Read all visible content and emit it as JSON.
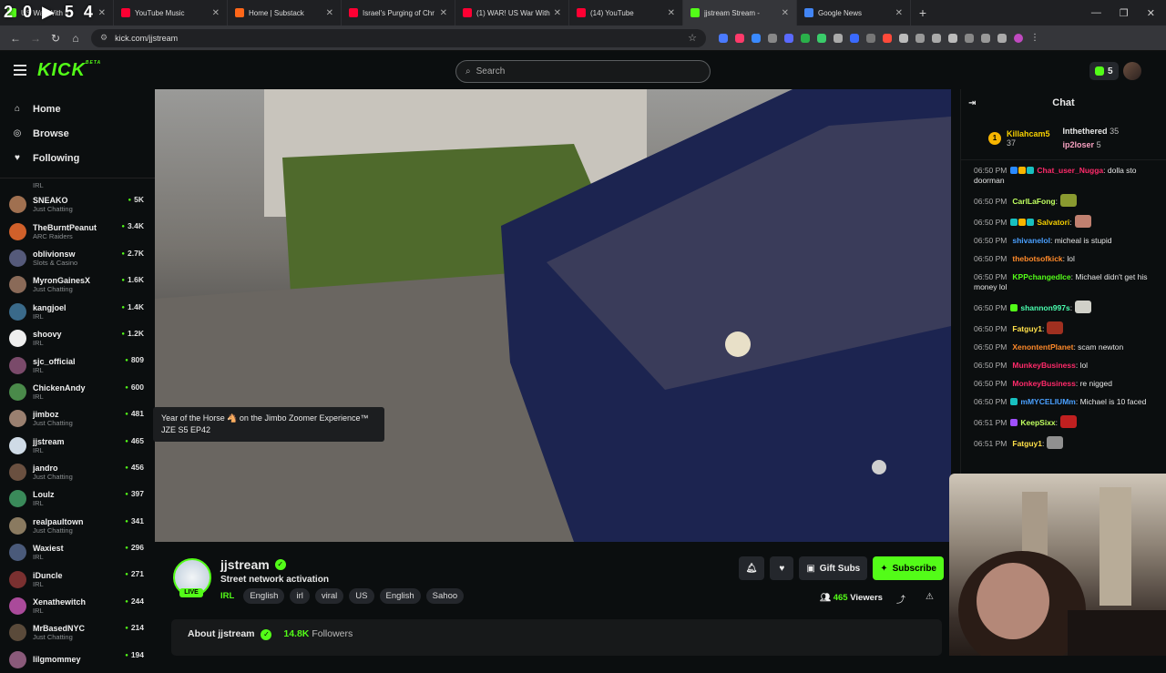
{
  "browser": {
    "tabs": [
      {
        "title": "US War With Ir",
        "color": "#53fc18"
      },
      {
        "title": "YouTube Music",
        "color": "#ff0033"
      },
      {
        "title": "Home | Substack",
        "color": "#ff6719"
      },
      {
        "title": "Israel's Purging of Chr",
        "color": "#ff0033"
      },
      {
        "title": "(1) WAR! US War With",
        "color": "#ff0033"
      },
      {
        "title": "(14) YouTube",
        "color": "#ff0033"
      },
      {
        "title": "jjstream Stream -",
        "color": "#53fc18"
      },
      {
        "title": "Google News",
        "color": "#4285f4"
      }
    ],
    "overlay": "2 0 ▶ 5 4",
    "url": "kick.com/jjstream",
    "newtab": "+",
    "win": [
      "—",
      "❐",
      "✕"
    ]
  },
  "header": {
    "logo": "KICK",
    "beta": "BETA",
    "search_placeholder": "Search",
    "points": "5"
  },
  "nav": [
    {
      "label": "Home",
      "icon": "⌂"
    },
    {
      "label": "Browse",
      "icon": "◎"
    },
    {
      "label": "Following",
      "icon": "♥"
    }
  ],
  "following": [
    {
      "name": "",
      "cat": "IRL",
      "viewers": "",
      "color": "#6a6a6a"
    },
    {
      "name": "SNEAKO",
      "cat": "Just Chatting",
      "viewers": "5K",
      "color": "#a07050"
    },
    {
      "name": "TheBurntPeanut",
      "cat": "ARC Raiders",
      "viewers": "3.4K",
      "color": "#d0602a"
    },
    {
      "name": "oblivionsw",
      "cat": "Slots & Casino",
      "viewers": "2.7K",
      "color": "#555a7a"
    },
    {
      "name": "MyronGainesX",
      "cat": "Just Chatting",
      "viewers": "1.6K",
      "color": "#8a6a58"
    },
    {
      "name": "kangjoel",
      "cat": "IRL",
      "viewers": "1.4K",
      "color": "#3a6a8a"
    },
    {
      "name": "shoovy",
      "cat": "IRL",
      "viewers": "1.2K",
      "color": "#eeeeee"
    },
    {
      "name": "sjc_official",
      "cat": "IRL",
      "viewers": "809",
      "color": "#7a4a6a"
    },
    {
      "name": "ChickenAndy",
      "cat": "IRL",
      "viewers": "600",
      "color": "#4a8a4a"
    },
    {
      "name": "jimboz",
      "cat": "Just Chatting",
      "viewers": "481",
      "color": "#9a8070"
    },
    {
      "name": "jjstream",
      "cat": "IRL",
      "viewers": "465",
      "color": "#cfdbe6"
    },
    {
      "name": "jandro",
      "cat": "Just Chatting",
      "viewers": "456",
      "color": "#6a5040"
    },
    {
      "name": "Loulz",
      "cat": "IRL",
      "viewers": "397",
      "color": "#3a8a5a"
    },
    {
      "name": "realpaultown",
      "cat": "Just Chatting",
      "viewers": "341",
      "color": "#8a7a60"
    },
    {
      "name": "Waxiest",
      "cat": "IRL",
      "viewers": "296",
      "color": "#4a5a7a"
    },
    {
      "name": "iDuncle",
      "cat": "IRL",
      "viewers": "271",
      "color": "#7a3030"
    },
    {
      "name": "Xenathewitch",
      "cat": "IRL",
      "viewers": "244",
      "color": "#aa4a9a"
    },
    {
      "name": "MrBasedNYC",
      "cat": "Just Chatting",
      "viewers": "214",
      "color": "#5a4a3a"
    },
    {
      "name": "lilgmommey",
      "cat": "",
      "viewers": "194",
      "color": "#8a5a7a"
    }
  ],
  "tooltip": "Year of the Horse 🐴 on the Jimbo Zoomer Experience™ JZE S5 EP42",
  "stream": {
    "channel": "jjstream",
    "title": "Street network activation",
    "live": "LIVE",
    "category": "IRL",
    "tags": [
      "English",
      "irl",
      "viral",
      "US",
      "English",
      "Sahoo"
    ],
    "gift": "Gift Subs",
    "subscribe": "Subscribe",
    "viewers_n": "465",
    "viewers_l": "Viewers",
    "about_prefix": "About jjstream",
    "followers_n": "14.8K",
    "followers_l": "Followers"
  },
  "chat": {
    "title": "Chat",
    "leaders": [
      {
        "name": "Killahcam5",
        "count": "37",
        "rank": "1"
      },
      {
        "name": "Inthethered",
        "count": "35"
      },
      {
        "name": "ip2loser",
        "count": "5"
      }
    ],
    "messages": [
      {
        "t": "06:50 PM",
        "u": "Chat_user_Nugga",
        "c": "#ff2a6a",
        "m": ": dolla sto doorman",
        "b": [
          "#2a8aff",
          "#f7b500",
          "#18c0c0"
        ]
      },
      {
        "t": "06:50 PM",
        "u": "CarlLaFong",
        "c": "#c0ff60",
        "m": ":",
        "b": [],
        "e": "#8a9a30"
      },
      {
        "t": "06:50 PM",
        "u": "Salvatori",
        "c": "#f7d000",
        "m": ":",
        "b": [
          "#18c0c0",
          "#f7b500",
          "#18c0c0"
        ],
        "e": "#c08070"
      },
      {
        "t": "06:50 PM",
        "u": "shivanelol",
        "c": "#4aa0ff",
        "m": ": micheal is stupid",
        "b": []
      },
      {
        "t": "06:50 PM",
        "u": "thebotsofkick",
        "c": "#ff8a2a",
        "m": ": lol",
        "b": []
      },
      {
        "t": "06:50 PM",
        "u": "KPPchangedIce",
        "c": "#53fc18",
        "m": ": Michael didn't get his money lol",
        "b": []
      },
      {
        "t": "06:50 PM",
        "u": "shannon997s",
        "c": "#4affb0",
        "m": ":",
        "b": [
          "#53fc18"
        ],
        "e": "#d0d0c8"
      },
      {
        "t": "06:50 PM",
        "u": "Fatguy1",
        "c": "#ffe04a",
        "m": ":",
        "b": [],
        "e": "#a03020"
      },
      {
        "t": "06:50 PM",
        "u": "XenontentPlanet",
        "c": "#ff8a2a",
        "m": ": scam newton",
        "b": []
      },
      {
        "t": "06:50 PM",
        "u": "MunkeyBusiness",
        "c": "#ff2a6a",
        "m": ": lol",
        "b": []
      },
      {
        "t": "06:50 PM",
        "u": "MonkeyBusiness",
        "c": "#ff2a6a",
        "m": ": re nigged",
        "b": []
      },
      {
        "t": "06:50 PM",
        "u": "mMYCELIUMm",
        "c": "#4aa0ff",
        "m": ": Michael is 10 faced",
        "b": [
          "#18c0c0"
        ]
      },
      {
        "t": "06:51 PM",
        "u": "KeepSixx",
        "c": "#c0ff60",
        "m": ":",
        "b": [
          "#a050ff"
        ],
        "e": "#c02020"
      },
      {
        "t": "06:51 PM",
        "u": "Fatguy1",
        "c": "#ffe04a",
        "m": ":",
        "b": [],
        "e": "#909090"
      }
    ]
  }
}
